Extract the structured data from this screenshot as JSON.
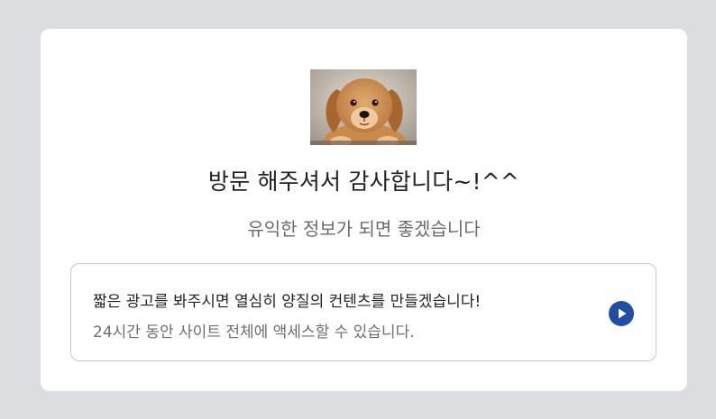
{
  "card": {
    "image": {
      "subject": "puppy-photo"
    },
    "title": "방문 해주셔서 감사합니다~!^^",
    "subtitle": "유익한 정보가 되면 좋겠습니다"
  },
  "offer": {
    "main_text": "짧은 광고를 봐주시면 열심히 양질의 컨텐츠를 만들겠습니다!",
    "sub_text": "24시간 동안 사이트 전체에 액세스할 수 있습니다.",
    "action_icon": "play-icon",
    "accent_color": "#1f4fa3"
  },
  "colors": {
    "background": "#dcdde0",
    "card": "#ffffff"
  }
}
